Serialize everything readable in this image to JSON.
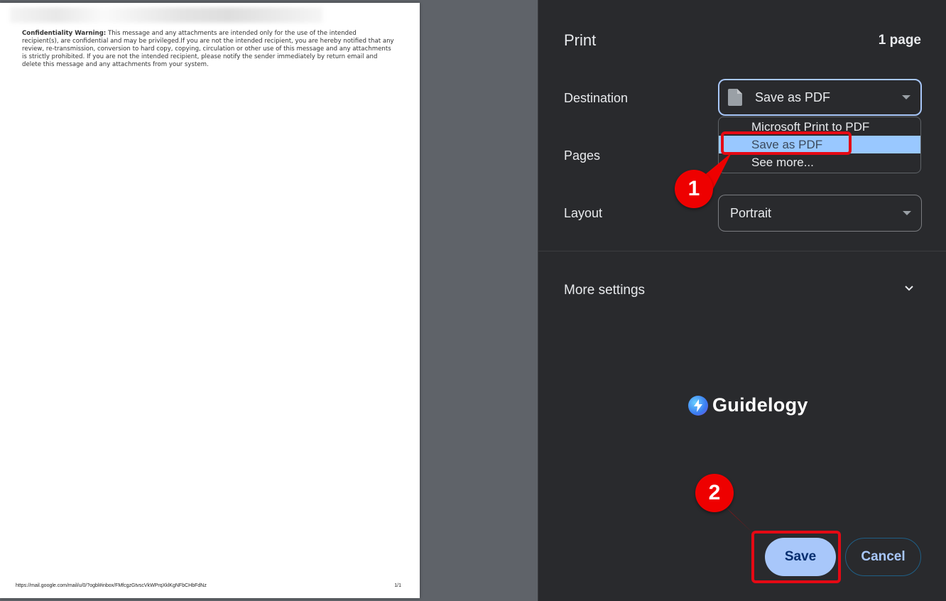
{
  "preview": {
    "confidentiality_label": "Confidentiality Warning:",
    "confidentiality_text": " This message and any attachments are intended only for the use of the intended recipient(s), are confidential and may be privileged.If you are not the intended recipient, you are hereby notified that any review, re-transmission, conversion to hard copy, copying, circulation or other use of this message and any attachments is strictly prohibited. If you are not the intended recipient, please notify the sender immediately by return email and delete this message and any attachments from your system.",
    "footer_url": "https://mail.google.com/mail/u/0/?ogbl#inbox/FMfcgzGtvscVkWPrqXklKgNFbCHbFdNz",
    "footer_page": "1/1"
  },
  "panel": {
    "title": "Print",
    "page_count": "1 page",
    "destination": {
      "label": "Destination",
      "value": "Save as PDF",
      "icon": "file-icon",
      "options": [
        {
          "label": "Microsoft Print to PDF",
          "selected": false
        },
        {
          "label": "Save as PDF",
          "selected": true
        },
        {
          "label": "See more...",
          "selected": false
        }
      ]
    },
    "pages": {
      "label": "Pages"
    },
    "layout": {
      "label": "Layout",
      "value": "Portrait"
    },
    "more_settings": {
      "label": "More settings",
      "icon": "chevron-down-icon"
    },
    "save_label": "Save",
    "cancel_label": "Cancel"
  },
  "watermark": {
    "text": "Guidelogy"
  },
  "annotations": {
    "step1": "1",
    "step2": "2",
    "highlight_color": "#e50914"
  },
  "colors": {
    "panel_bg": "#292a2d",
    "accent": "#a8c7fa",
    "selected_option_bg": "#99c8ff"
  }
}
